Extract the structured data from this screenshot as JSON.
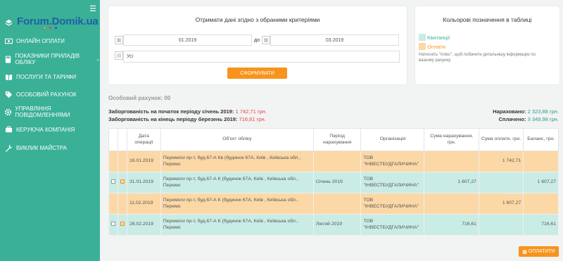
{
  "sidebar": {
    "logo": "Forum.Domik.ua",
    "items": [
      {
        "label": "",
        "icon": "layers-icon"
      },
      {
        "label": "Онлайн оплати",
        "icon": "money-icon"
      },
      {
        "label": "Показники приладів обліку",
        "icon": "calculator-icon"
      },
      {
        "label": "Послуги та тарифи",
        "icon": "book-icon"
      },
      {
        "label": "Особовий рахунок",
        "icon": "tag-icon"
      },
      {
        "label": "Управління повідомленнями",
        "icon": "gear-icon"
      },
      {
        "label": "Керуюча компанія",
        "icon": "building-icon"
      },
      {
        "label": "Виклик майстра",
        "icon": "wrench-icon"
      }
    ]
  },
  "filter": {
    "title": "Отримати дані згідно з обраними критеріями",
    "date_from": "01.2019",
    "to_label": "до",
    "date_to": "03.2019",
    "select_value": "Усі",
    "submit_label": "Сформувати"
  },
  "legend": {
    "title": "Кольорові позначення в таблиці",
    "items": [
      {
        "label": "Квитанції",
        "color": "#c9ece5",
        "text_color": "#3ab097"
      },
      {
        "label": "Оплати",
        "color": "#fbd8a6",
        "text_color": "#f7941d"
      }
    ],
    "hint": "Натисніть \"плюс\", щоб побачити детальнішу інформацію по вашому рахунку."
  },
  "account": {
    "label": "Особовий рахунок: 00"
  },
  "summary": {
    "debt_start_label": "Заборгованість на початок періоду січень 2019:",
    "debt_start_value": "1 742,71 грн.",
    "debt_end_label": "Заборгованість на кінець періоду березень 2019:",
    "debt_end_value": "716,61 грн.",
    "charged_label": "Нараховано:",
    "charged_value": "2 323,88 грн.",
    "paid_label": "Сплачено:",
    "paid_value": "3 349,98 грн."
  },
  "table": {
    "headers": [
      "Дата операції",
      "Об'єкт обліку",
      "Період нарахування",
      "Організація",
      "Сума нарахування, грн.",
      "Сума оплати, грн.",
      "Баланс, грн."
    ],
    "rows": [
      {
        "type": "orange",
        "date": "16.01.2019",
        "object": "Перемоги пр-т, буд.67-А Кв (будинок 67А, Київ , Київська обл., Перемо",
        "period": "",
        "org": "ТОВ \"ІНВЕСТБУДГАЛИЧИНА\"",
        "charge": "",
        "payment": "1 742,71",
        "balance": ""
      },
      {
        "type": "teal",
        "date": "31.01.2019",
        "object": "Перемоги пр-т, буд.67-А К (будинок 67А, Київ , Київська обл., Перемо",
        "period": "Січень 2019",
        "org": "ТОВ \"ІНВЕСТБУДГАЛИЧИНА\"",
        "charge": "1 607,27",
        "payment": "",
        "balance": "1 607,27"
      },
      {
        "type": "orange",
        "date": "11.02.2019",
        "object": "Перемоги пр-т, буд.67-А К (будинок 67А, Київ , Київська обл., Перемо",
        "period": "",
        "org": "ТОВ \"ІНВЕСТБУДГАЛИЧИНА\"",
        "charge": "",
        "payment": "1 607,27",
        "balance": ""
      },
      {
        "type": "teal",
        "date": "28.02.2019",
        "object": "Перемоги пр-т, буд.67-А К (будинок 67А, Київ , Київська обл., Перемо",
        "period": "Лютий 2019",
        "org": "ТОВ \"ІНВЕСТБУДГАЛИЧИНА\"",
        "charge": "716,61",
        "payment": "",
        "balance": "716,61"
      }
    ]
  },
  "pay_button": "Оплатити",
  "colors": {
    "sidebar": "#3ab097",
    "accent": "#f7941d",
    "red": "#e2454b",
    "green": "#2a9d8f"
  }
}
